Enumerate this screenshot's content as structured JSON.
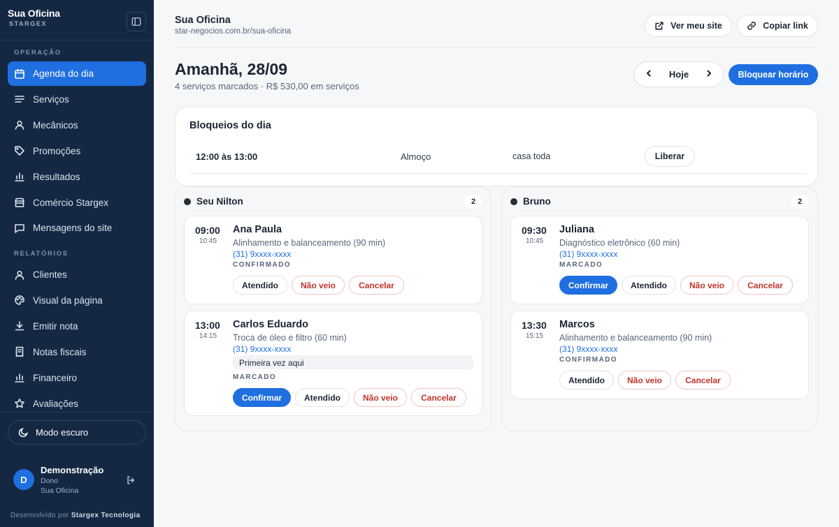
{
  "sidebar": {
    "brand_title": "Sua Oficina",
    "brand_sub": "STARGEX",
    "section_operation": "OPERAÇÃO",
    "section_reports": "RELATÓRIOS",
    "operation_items": [
      {
        "label": "Agenda do dia",
        "icon": "calendar-icon",
        "active": true
      },
      {
        "label": "Serviços",
        "icon": "list-icon"
      },
      {
        "label": "Mecânicos",
        "icon": "user-icon"
      },
      {
        "label": "Promoções",
        "icon": "tag-icon"
      },
      {
        "label": "Resultados",
        "icon": "bar-chart-icon"
      },
      {
        "label": "Comércio Stargex",
        "icon": "store-icon"
      },
      {
        "label": "Mensagens do site",
        "icon": "message-icon"
      }
    ],
    "report_items": [
      {
        "label": "Clientes",
        "icon": "user-icon"
      },
      {
        "label": "Visual da página",
        "icon": "palette-icon"
      },
      {
        "label": "Emitir nota",
        "icon": "download-icon"
      },
      {
        "label": "Notas fiscais",
        "icon": "receipt-icon"
      },
      {
        "label": "Financeiro",
        "icon": "bar-chart-icon"
      },
      {
        "label": "Avaliações",
        "icon": "star-icon"
      }
    ],
    "dark_mode_label": "Modo escuro",
    "user": {
      "initial": "D",
      "name": "Demonstração",
      "role": "Dono",
      "org": "Sua Oficina"
    },
    "footer_prefix": "Desenvolvido por",
    "footer_company": "Stargex Tecnologia"
  },
  "header": {
    "site_name": "Sua Oficina",
    "site_url": "star-negocios.com.br/sua-oficina",
    "view_site_label": "Ver meu site",
    "copy_link_label": "Copiar link"
  },
  "day": {
    "title": "Amanhã, 28/09",
    "summary": "4 serviços marcados · R$ 530,00 em serviços",
    "today_label": "Hoje",
    "block_button_label": "Bloquear horário"
  },
  "blocks": {
    "title": "Bloqueios do dia",
    "rows": [
      {
        "time": "12:00 às 13:00",
        "reason": "Almoço",
        "scope": "casa toda",
        "action": "Liberar"
      }
    ]
  },
  "columns": [
    {
      "mechanic": "Seu Nilton",
      "count": "2",
      "appointments": [
        {
          "start": "09:00",
          "end": "10:45",
          "name": "Ana Paula",
          "service": "Alinhamento e balanceamento (90 min)",
          "phone": "(31) 9xxxx-xxxx",
          "note": "",
          "status": "CONFIRMADO",
          "actions": [
            "Atendido",
            "Não veio",
            "Cancelar"
          ]
        },
        {
          "start": "13:00",
          "end": "14:15",
          "name": "Carlos Eduardo",
          "service": "Troca de óleo e filtro (60 min)",
          "phone": "(31) 9xxxx-xxxx",
          "note": "Primeira vez aqui",
          "status": "MARCADO",
          "actions": [
            "Confirmar",
            "Atendido",
            "Não veio",
            "Cancelar"
          ]
        }
      ]
    },
    {
      "mechanic": "Bruno",
      "count": "2",
      "appointments": [
        {
          "start": "09:30",
          "end": "10:45",
          "name": "Juliana",
          "service": "Diagnóstico eletrônico (60 min)",
          "phone": "(31) 9xxxx-xxxx",
          "note": "",
          "status": "MARCADO",
          "actions": [
            "Confirmar",
            "Atendido",
            "Não veio",
            "Cancelar"
          ]
        },
        {
          "start": "13:30",
          "end": "15:15",
          "name": "Marcos",
          "service": "Alinhamento e balanceamento (90 min)",
          "phone": "(31) 9xxxx-xxxx",
          "note": "",
          "status": "CONFIRMADO",
          "actions": [
            "Atendido",
            "Não veio",
            "Cancelar"
          ]
        }
      ]
    }
  ],
  "colors": {
    "accent": "#1f6fe0",
    "sidebar_bg": "#142844",
    "danger": "#c0352b"
  }
}
